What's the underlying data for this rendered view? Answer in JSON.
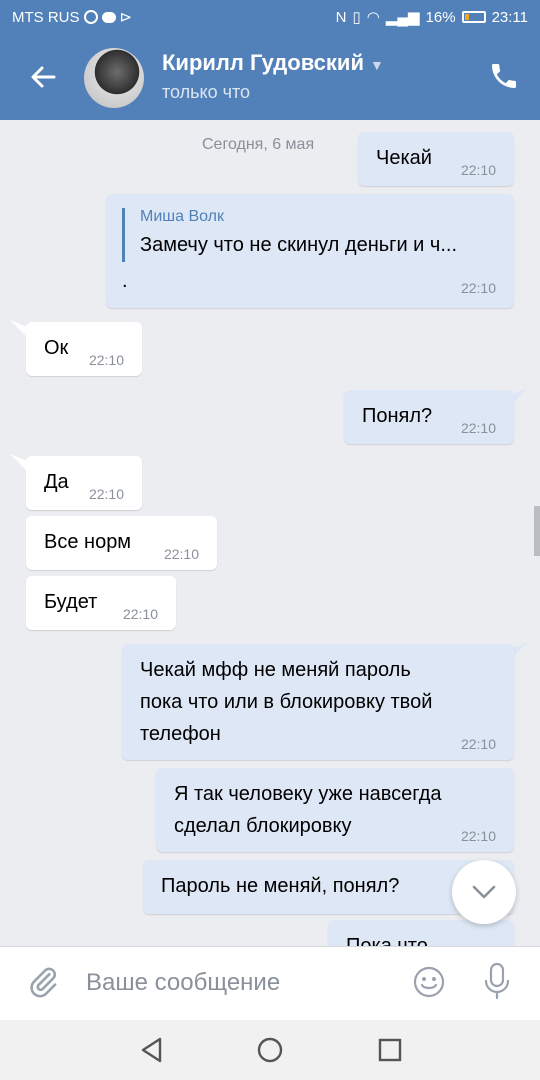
{
  "status_bar": {
    "carrier": "MTS RUS",
    "battery": "16%",
    "time": "23:11"
  },
  "header": {
    "contact_name": "Кирилл Гудовский",
    "status": "только что"
  },
  "chat": {
    "date_label": "Сегодня, 6 мая",
    "messages": [
      {
        "dir": "out",
        "text": "Чекай",
        "time": "22:10"
      },
      {
        "dir": "out",
        "reply_to": "Миша Волк",
        "reply_text": "Замечу что не скинул деньги и ч...",
        "text": ".",
        "time": "22:10"
      },
      {
        "dir": "in",
        "text": "Ок",
        "time": "22:10"
      },
      {
        "dir": "out",
        "text": "Понял?",
        "time": "22:10"
      },
      {
        "dir": "in",
        "text": "Да",
        "time": "22:10"
      },
      {
        "dir": "in",
        "text": "Все норм",
        "time": "22:10"
      },
      {
        "dir": "in",
        "text": "Будет",
        "time": "22:10"
      },
      {
        "dir": "out",
        "lines": [
          "Чекай мфф не меняй пароль",
          "пока что или в блокировку твой",
          "телефон"
        ],
        "time": "22:10"
      },
      {
        "dir": "out",
        "lines": [
          "Я так человеку уже навсегда",
          "сделал блокировку"
        ],
        "time": "22:10"
      },
      {
        "dir": "out",
        "text": "Пароль не меняй, понял?",
        "time": ""
      },
      {
        "dir": "out",
        "text": "Пока что",
        "time": ""
      }
    ]
  },
  "composer": {
    "placeholder": "Ваше сообщение"
  },
  "icons": {
    "back": "arrow-left-icon",
    "call": "phone-icon",
    "attach": "paperclip-icon",
    "emoji": "smile-icon",
    "mic": "microphone-icon",
    "scroll_down": "chevron-down-icon"
  },
  "colors": {
    "header": "#5181b8",
    "outgoing_bubble": "#dde7f5",
    "incoming_bubble": "#ffffff",
    "background": "#ebedf0"
  }
}
